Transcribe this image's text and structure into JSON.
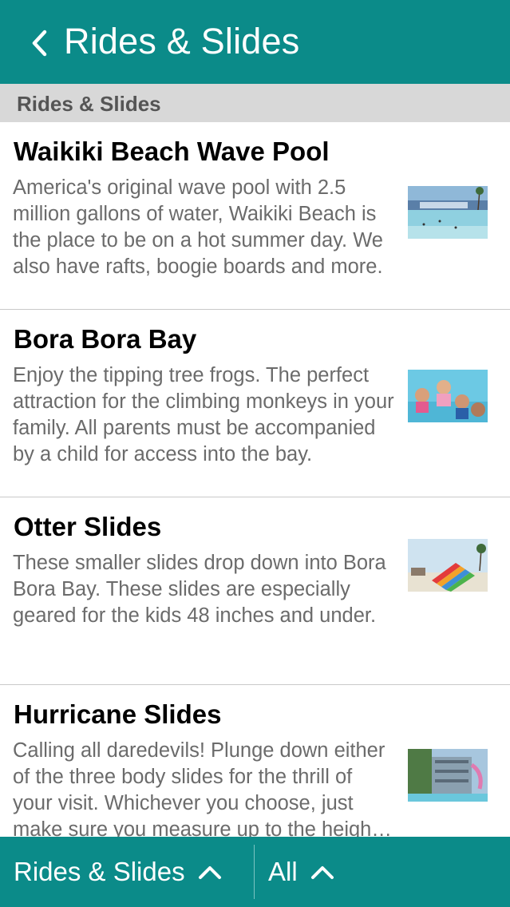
{
  "header": {
    "title": "Rides & Slides",
    "back_icon": "chevron-left-icon"
  },
  "section": {
    "title": "Rides & Slides"
  },
  "items": [
    {
      "title": "Waikiki Beach Wave Pool",
      "description": "America's original wave pool with 2.5 million gallons of water, Waikiki Beach is the place to be on a hot summer day. We also have rafts, boogie boards and more.",
      "thumbnail": "wave-pool-photo"
    },
    {
      "title": "Bora Bora Bay",
      "description": "Enjoy the tipping tree frogs. The perfect attraction for the climbing monkeys in your family. All parents must be accompanied by a child for access into the bay.",
      "thumbnail": "kids-in-pool-photo"
    },
    {
      "title": "Otter Slides",
      "description": "These smaller slides drop down into Bora Bora Bay. These slides are especially geared for the kids 48 inches and under.",
      "thumbnail": "colorful-slides-photo"
    },
    {
      "title": "Hurricane Slides",
      "description": "Calling all daredevils! Plunge down either of the three body slides for the thrill of your visit. Whichever you choose, just make sure you measure up to the height requirement.",
      "thumbnail": "slide-tower-photo"
    }
  ],
  "footer": {
    "category_label": "Rides & Slides",
    "filter_label": "All",
    "chevron_icon": "chevron-up-icon"
  },
  "colors": {
    "primary": "#0b8b89",
    "section_bg": "#d8d8d8",
    "description_text": "#6b6b6b"
  }
}
